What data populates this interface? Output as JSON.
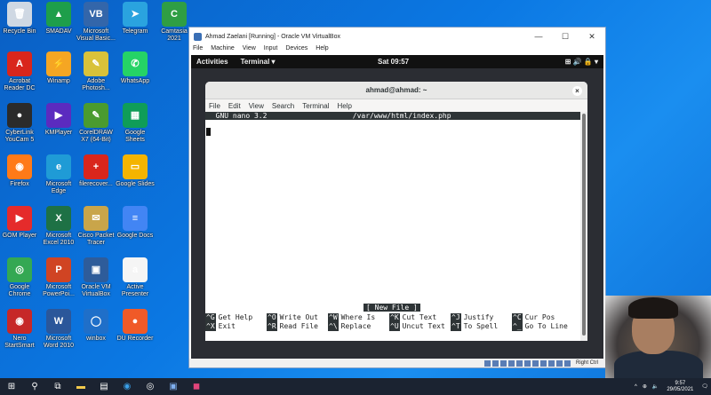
{
  "desktop": {
    "icons": [
      {
        "label": "Recycle Bin",
        "color": "#cfd8e3",
        "glyph": "🗑"
      },
      {
        "label": "Acrobat Reader DC",
        "color": "#d9261c",
        "glyph": "A"
      },
      {
        "label": "CyberLink YouCam 5",
        "color": "#2b2b2b",
        "glyph": "●"
      },
      {
        "label": "Firefox",
        "color": "#ff7a18",
        "glyph": "◉"
      },
      {
        "label": "GOM Player",
        "color": "#e52b2b",
        "glyph": "▶"
      },
      {
        "label": "Google Chrome",
        "color": "#34a853",
        "glyph": "◎"
      },
      {
        "label": "Nero StartSmart",
        "color": "#c62828",
        "glyph": "◉"
      },
      {
        "label": "SMADAV",
        "color": "#1e9e4a",
        "glyph": "▲"
      },
      {
        "label": "Winamp",
        "color": "#f5a623",
        "glyph": "⚡"
      },
      {
        "label": "KMPlayer",
        "color": "#5b2bbf",
        "glyph": "▶"
      },
      {
        "label": "Microsoft Edge",
        "color": "#1f9bd6",
        "glyph": "e"
      },
      {
        "label": "Microsoft Excel 2010",
        "color": "#1e7145",
        "glyph": "X"
      },
      {
        "label": "Microsoft PowerPoi...",
        "color": "#d04423",
        "glyph": "P"
      },
      {
        "label": "Microsoft Word 2010",
        "color": "#2b579a",
        "glyph": "W"
      },
      {
        "label": "Microsoft Visual Basic...",
        "color": "#3366aa",
        "glyph": "VB"
      },
      {
        "label": "Adobe Photosh...",
        "color": "#d9c23a",
        "glyph": "✎"
      },
      {
        "label": "CorelDRAW X7 (64-Bit)",
        "color": "#4a9b2f",
        "glyph": "✎"
      },
      {
        "label": "filerecover...",
        "color": "#d9261c",
        "glyph": "+"
      },
      {
        "label": "Cisco Packet Tracer",
        "color": "#c9a54a",
        "glyph": "✉"
      },
      {
        "label": "Oracle VM VirtualBox",
        "color": "#2e5c9a",
        "glyph": "▣"
      },
      {
        "label": "winbox",
        "color": "#1f6fc9",
        "glyph": "◯"
      },
      {
        "label": "Telegram",
        "color": "#2aa3df",
        "glyph": "➤"
      },
      {
        "label": "WhatsApp",
        "color": "#25d366",
        "glyph": "✆"
      },
      {
        "label": "Google Sheets",
        "color": "#0f9d58",
        "glyph": "▦"
      },
      {
        "label": "Google Slides",
        "color": "#f4b400",
        "glyph": "▭"
      },
      {
        "label": "Google Docs",
        "color": "#4285f4",
        "glyph": "≡"
      },
      {
        "label": "Active Presenter",
        "color": "#f5f5f5",
        "glyph": "a"
      },
      {
        "label": "DU Recorder",
        "color": "#f05a28",
        "glyph": "●"
      },
      {
        "label": "Camtasia 2021",
        "color": "#2f9e44",
        "glyph": "C"
      }
    ]
  },
  "vbox": {
    "title": "Ahmad Zaelani [Running] - Oracle VM VirtualBox",
    "menu": [
      "File",
      "Machine",
      "View",
      "Input",
      "Devices",
      "Help"
    ],
    "controls": {
      "minimize": "—",
      "maximize": "☐",
      "close": "✕"
    },
    "status_host_key": "Right Ctrl"
  },
  "gnome": {
    "activities": "Activities",
    "app_menu": "Terminal ▾",
    "clock": "Sat 09:57",
    "system": "⊞  🔊  🔒 ▾"
  },
  "terminal": {
    "title": "ahmad@ahmad: ~",
    "close": "×",
    "menu": [
      "File",
      "Edit",
      "View",
      "Search",
      "Terminal",
      "Help"
    ]
  },
  "nano": {
    "header": "  GNU nano 3.2                    /var/www/html/index.php",
    "status": "[ New File ]",
    "shortcuts_row1": [
      {
        "key": "^G",
        "label": "Get Help"
      },
      {
        "key": "^O",
        "label": "Write Out"
      },
      {
        "key": "^W",
        "label": "Where Is"
      },
      {
        "key": "^K",
        "label": "Cut Text"
      },
      {
        "key": "^J",
        "label": "Justify"
      },
      {
        "key": "^C",
        "label": "Cur Pos"
      }
    ],
    "shortcuts_row2": [
      {
        "key": "^X",
        "label": "Exit"
      },
      {
        "key": "^R",
        "label": "Read File"
      },
      {
        "key": "^\\",
        "label": "Replace"
      },
      {
        "key": "^U",
        "label": "Uncut Text"
      },
      {
        "key": "^T",
        "label": "To Spell"
      },
      {
        "key": "^_",
        "label": "Go To Line"
      }
    ]
  },
  "taskbar": {
    "time": "9:57",
    "date": "29/05/2021",
    "tray_arrow": "^",
    "notification": "🗨"
  }
}
